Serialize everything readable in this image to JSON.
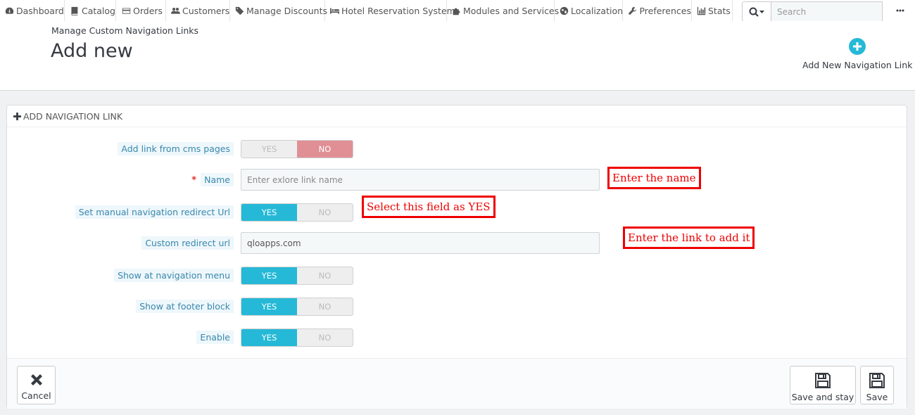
{
  "nav": {
    "items": [
      {
        "label": "Dashboard",
        "icon": "dashboard-icon"
      },
      {
        "label": "Catalog",
        "icon": "book-icon"
      },
      {
        "label": "Orders",
        "icon": "credit-card-icon"
      },
      {
        "label": "Customers",
        "icon": "users-icon"
      },
      {
        "label": "Manage Discounts",
        "icon": "tags-icon"
      },
      {
        "label": "Hotel Reservation System",
        "icon": "bed-icon"
      },
      {
        "label": "Modules and Services",
        "icon": "puzzle-icon"
      },
      {
        "label": "Localization",
        "icon": "globe-icon"
      },
      {
        "label": "Preferences",
        "icon": "wrench-icon"
      },
      {
        "label": "Stats",
        "icon": "bar-chart-icon"
      }
    ],
    "search_placeholder": "Search"
  },
  "header": {
    "breadcrumb": "Manage Custom Navigation Links",
    "title": "Add new",
    "add_button_label": "Add New Navigation Link"
  },
  "panel": {
    "heading": "ADD NAVIGATION LINK",
    "fields": {
      "cms_pages": {
        "label": "Add link from cms pages",
        "yes": "YES",
        "no": "NO",
        "value": "NO"
      },
      "name": {
        "label": "Name",
        "required_mark": "*",
        "placeholder": "Enter exlore link name",
        "value": ""
      },
      "manual_redirect": {
        "label": "Set manual navigation redirect Url",
        "yes": "YES",
        "no": "NO",
        "value": "YES"
      },
      "custom_url": {
        "label": "Custom redirect url",
        "value": "qloapps.com"
      },
      "show_nav": {
        "label": "Show at navigation menu",
        "yes": "YES",
        "no": "NO",
        "value": "YES"
      },
      "show_footer": {
        "label": "Show at footer block",
        "yes": "YES",
        "no": "NO",
        "value": "YES"
      },
      "enable": {
        "label": "Enable",
        "yes": "YES",
        "no": "NO",
        "value": "YES"
      }
    },
    "footer": {
      "cancel": "Cancel",
      "save_and_stay": "Save and stay",
      "save": "Save"
    }
  },
  "annotations": {
    "name": "Enter the name",
    "manual_redirect": "Select this field as YES",
    "custom_url": "Enter the link to add it"
  },
  "colors": {
    "accent": "#25b9d7",
    "no_active": "#e08f95",
    "annotation": "#ee0000"
  }
}
